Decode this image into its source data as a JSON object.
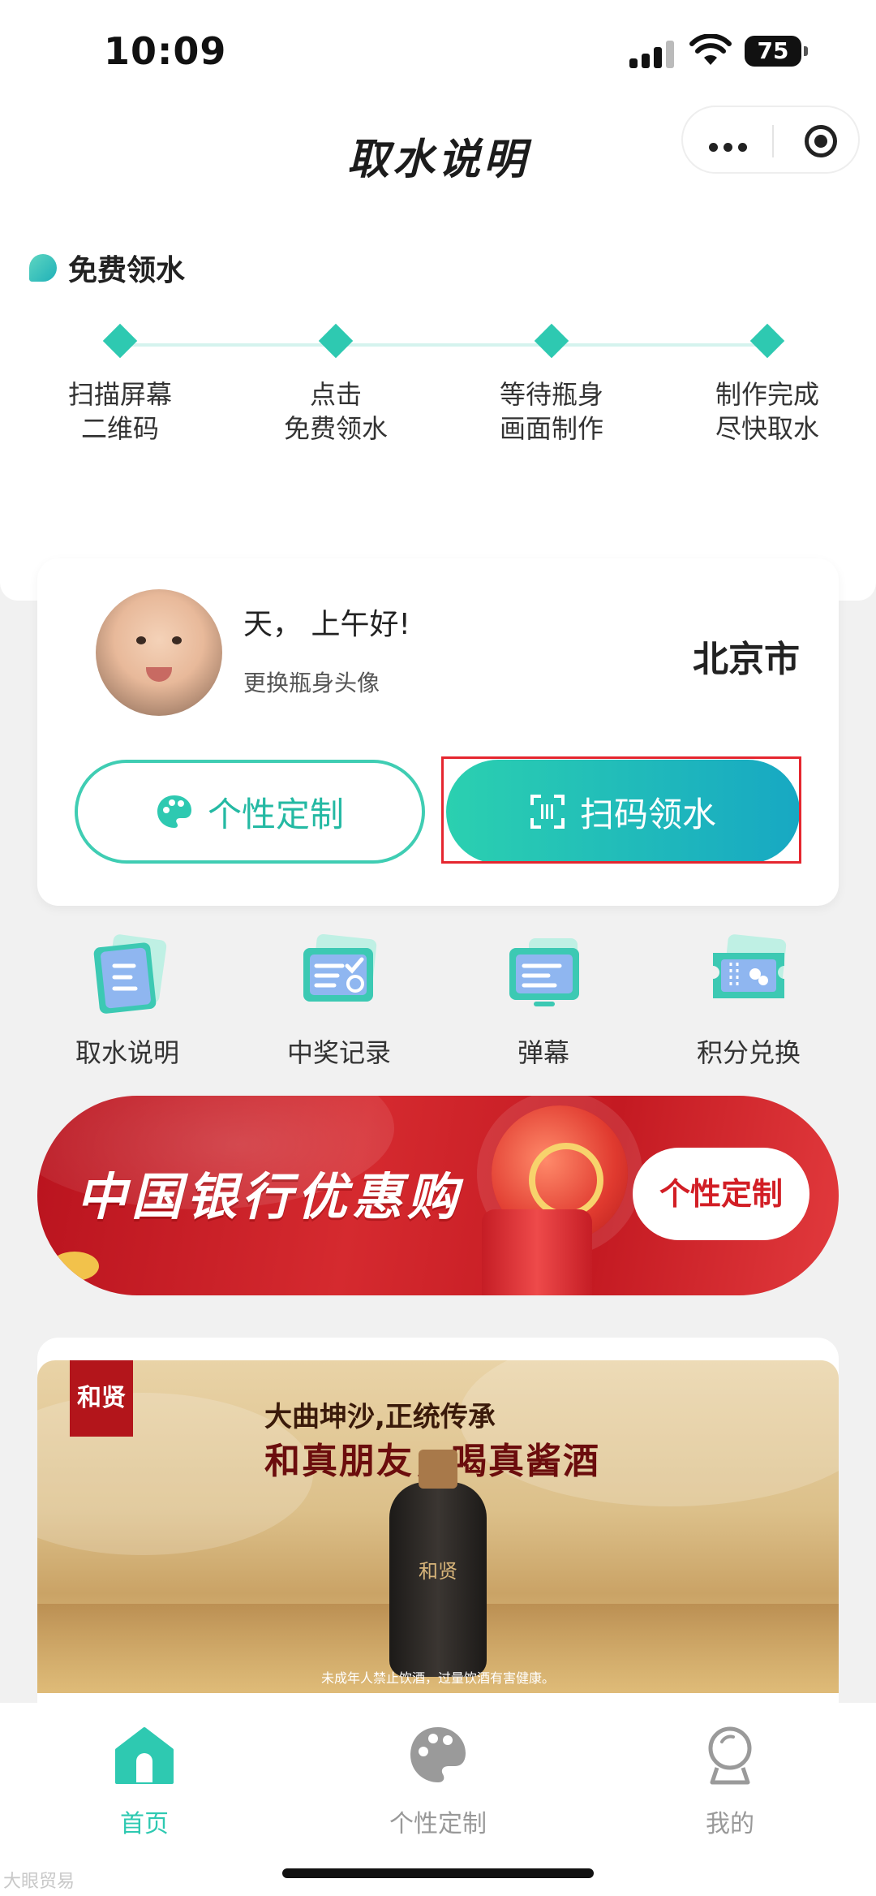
{
  "status_bar": {
    "time": "10:09",
    "battery": "75"
  },
  "header": {
    "title": "取水说明"
  },
  "steps_section": {
    "title": "免费领水",
    "steps": [
      {
        "line1": "扫描屏幕",
        "line2": "二维码"
      },
      {
        "line1": "点击",
        "line2": "免费领水"
      },
      {
        "line1": "等待瓶身",
        "line2": "画面制作"
      },
      {
        "line1": "制作完成",
        "line2": "尽快取水"
      }
    ],
    "accent_color": "#2ec9b1"
  },
  "user_card": {
    "greeting": "天， 上午好!",
    "change_avatar": "更换瓶身头像",
    "city": "北京市",
    "custom_button": "个性定制",
    "scan_button": "扫码领水"
  },
  "quick_menu": [
    {
      "label": "取水说明",
      "icon": "instructions-icon"
    },
    {
      "label": "中奖记录",
      "icon": "prize-record-icon"
    },
    {
      "label": "弹幕",
      "icon": "danmaku-icon"
    },
    {
      "label": "积分兑换",
      "icon": "points-exchange-icon"
    }
  ],
  "bank_banner": {
    "title": "中国银行优惠购",
    "button": "个性定制",
    "color": "#c41a22"
  },
  "ad_banner": {
    "brand": "和贤",
    "subtitle": "大曲坤沙,正统传承",
    "headline": "和真朋友，喝真酱酒",
    "bottle_label": "和贤",
    "warning": "未成年人禁止饮酒，过量饮酒有害健康。"
  },
  "tab_bar": {
    "items": [
      {
        "label": "首页",
        "icon": "home-icon",
        "active": true
      },
      {
        "label": "个性定制",
        "icon": "palette-icon",
        "active": false
      },
      {
        "label": "我的",
        "icon": "profile-icon",
        "active": false
      }
    ]
  },
  "watermark": "大眼贸易"
}
